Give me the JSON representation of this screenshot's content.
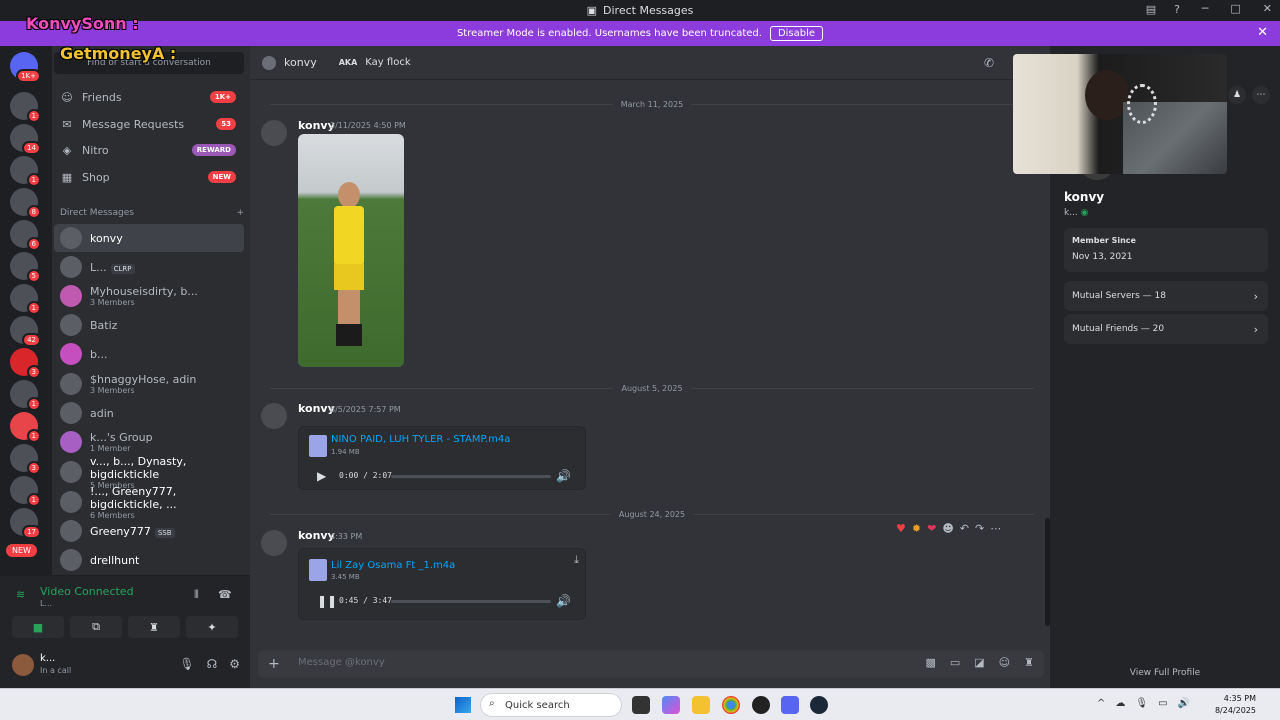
{
  "window": {
    "title": "Direct Messages"
  },
  "banner": {
    "text": "Streamer Mode is enabled. Usernames have been truncated.",
    "disable_label": "Disable"
  },
  "overlay": {
    "line1": "KonvySonn : ",
    "line2": "GetmoneyA : "
  },
  "dm_sidebar": {
    "search_label": "Find or start a conversation",
    "nav": [
      {
        "label": "Friends",
        "badge": "1K+"
      },
      {
        "label": "Message Requests",
        "badge": "53"
      },
      {
        "label": "Nitro",
        "badge": "REWARD"
      },
      {
        "label": "Shop",
        "badge": "NEW"
      }
    ],
    "dm_header": "Direct Messages",
    "dm_add": "+",
    "items": [
      {
        "name": "konvy",
        "sub": "",
        "tag": ""
      },
      {
        "name": "L...",
        "sub": "",
        "tag": "CLRP"
      },
      {
        "name": "Myhouseisdirty, b...",
        "sub": "3 Members",
        "tag": ""
      },
      {
        "name": "Batiz",
        "sub": "",
        "tag": ""
      },
      {
        "name": "b...",
        "sub": "",
        "tag": ""
      },
      {
        "name": "$hnaggyHose, adin",
        "sub": "3 Members",
        "tag": ""
      },
      {
        "name": "adin",
        "sub": "",
        "tag": ""
      },
      {
        "name": "k...'s Group",
        "sub": "1 Member",
        "tag": ""
      },
      {
        "name": "v..., b..., Dynasty, bigdicktickle",
        "sub": "5 Members",
        "tag": ""
      },
      {
        "name": "!..., Greeny777, bigdicktickle, ...",
        "sub": "6 Members",
        "tag": ""
      },
      {
        "name": "Greeny777",
        "sub": "",
        "tag": "SSB"
      },
      {
        "name": "drellhunt",
        "sub": "",
        "tag": ""
      }
    ]
  },
  "server_rail": {
    "badges": [
      "1K+",
      "1",
      "14",
      "1",
      "8",
      "6",
      "5",
      "1",
      "42",
      "3",
      "1",
      "1",
      "3",
      "1",
      "17"
    ],
    "new_label": "NEW"
  },
  "voice": {
    "status": "Video Connected",
    "sub": "L..."
  },
  "user": {
    "name": "k...",
    "status": "In a call"
  },
  "chat": {
    "recipient": "konvy",
    "aka_label": "AKA",
    "alias": "Kay flock",
    "messages": [
      {
        "date": "March 11, 2025",
        "author": "konvy",
        "time": "3/11/2025 4:50 PM"
      },
      {
        "date": "August 5, 2025",
        "author": "konvy",
        "time": "8/5/2025 7:57 PM",
        "file": {
          "name": "NINO PAID, LUH TYLER - STAMP.m4a",
          "size": "1.94 MB",
          "duration": "0:00 / 2:07",
          "progress": 0
        }
      },
      {
        "date": "August 24, 2025",
        "author": "konvy",
        "time": "4:33 PM",
        "file": {
          "name": "Lil Zay Osama Ft _1.m4a",
          "size": "3.45 MB",
          "duration": "0:45 / 3:47",
          "progress": 0.2
        }
      }
    ],
    "composer_placeholder": "Message @konvy"
  },
  "profile": {
    "name": "konvy",
    "sub": "k...",
    "member_since_label": "Member Since",
    "member_since": "Nov 13, 2021",
    "mutual_servers": "Mutual Servers — 18",
    "mutual_friends": "Mutual Friends — 20",
    "view_full": "View Full Profile"
  },
  "taskbar": {
    "search_label": "Quick search",
    "time": "4:35 PM",
    "date": "8/24/2025"
  },
  "colors": {
    "accent": "#5865f2",
    "banner": "#8c3cdc",
    "online": "#23a55a",
    "danger": "#f23f43"
  }
}
